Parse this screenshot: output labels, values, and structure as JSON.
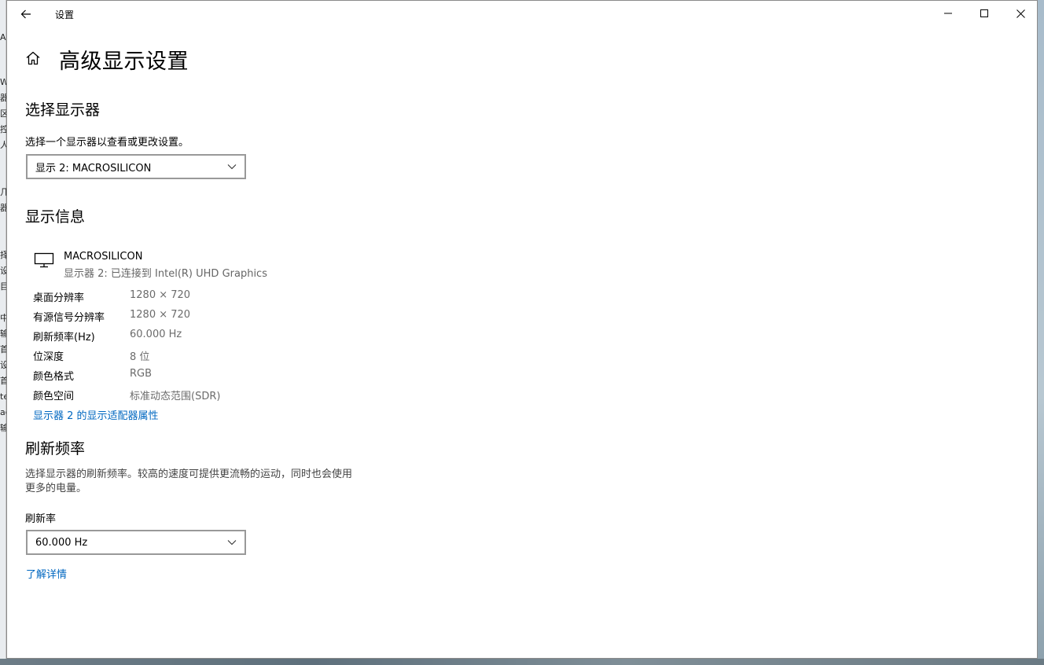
{
  "window": {
    "app_title": "设置",
    "page_title": "高级显示设置"
  },
  "select_display": {
    "heading": "选择显示器",
    "description": "选择一个显示器以查看或更改设置。",
    "selected": "显示 2: MACROSILICON"
  },
  "display_info": {
    "heading": "显示信息",
    "monitor_name": "MACROSILICON",
    "monitor_sub": "显示器 2: 已连接到 Intel(R) UHD Graphics",
    "rows": [
      {
        "key": "桌面分辨率",
        "value": "1280 × 720"
      },
      {
        "key": "有源信号分辨率",
        "value": "1280 × 720"
      },
      {
        "key": "刷新频率(Hz)",
        "value": "60.000 Hz"
      },
      {
        "key": "位深度",
        "value": "8 位"
      },
      {
        "key": "颜色格式",
        "value": "RGB"
      },
      {
        "key": "颜色空间",
        "value": "标准动态范围(SDR)"
      }
    ],
    "adapter_link": "显示器 2 的显示适配器属性"
  },
  "refresh_rate": {
    "heading": "刷新频率",
    "description_line1": "选择显示器的刷新频率。较高的速度可提供更流畅的运动，同时也会使用",
    "description_line2": "更多的电量。",
    "label": "刷新率",
    "selected": "60.000 Hz",
    "learn_more": "了解详情"
  },
  "background_peek": [
    "W",
    "器",
    "区",
    "控",
    "人",
    "几",
    "器",
    "择",
    "设",
    "目",
    "中",
    "输",
    "首",
    "设",
    "首",
    "te",
    "ac",
    "输"
  ]
}
